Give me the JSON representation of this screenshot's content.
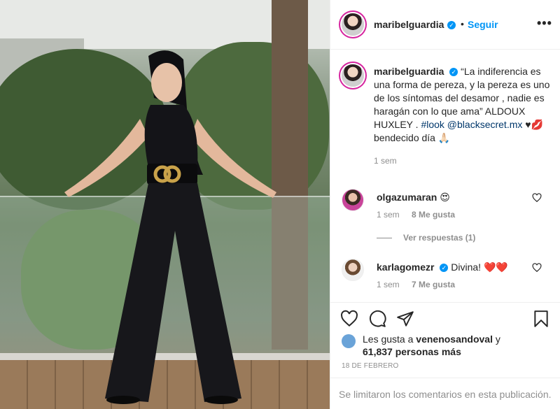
{
  "post": {
    "username": "maribelguardia",
    "verified_icon": "verified-badge-icon",
    "follow_label": "Seguir",
    "more_label": "•••"
  },
  "caption": {
    "username": "maribelguardia",
    "text_part1": "“La indiferencia es una forma de pereza, y la pereza es uno de los síntomas del desamor , nadie es haragán con lo que ama” ALDOUX HUXLEY . ",
    "hashtag": "#look",
    "mention": "@blacksecret.mx",
    "text_part2": " ♥💋 bendecido día 🙏🏻",
    "time": "1 sem"
  },
  "comments": [
    {
      "username": "olgazumaran",
      "text": "😍",
      "time": "1 sem",
      "likes": "8 Me gusta"
    },
    {
      "username": "karlagomezr",
      "text": "Divina! ❤️❤️",
      "time": "1 sem",
      "likes": "7 Me gusta"
    }
  ],
  "replies_label": "Ver respuestas (1)",
  "likes": {
    "line1_prefix": "Les gusta a",
    "liker": "venenosandoval",
    "line1_suffix": "y",
    "count_text": "61,837 personas más"
  },
  "date": "18 DE FEBRERO",
  "comments_limited": "Se limitaron los comentarios en esta publicación.",
  "colors": {
    "accent": "#0095f6",
    "text": "#262626",
    "muted": "#8e8e8e",
    "heart_red": "#ed4956"
  }
}
